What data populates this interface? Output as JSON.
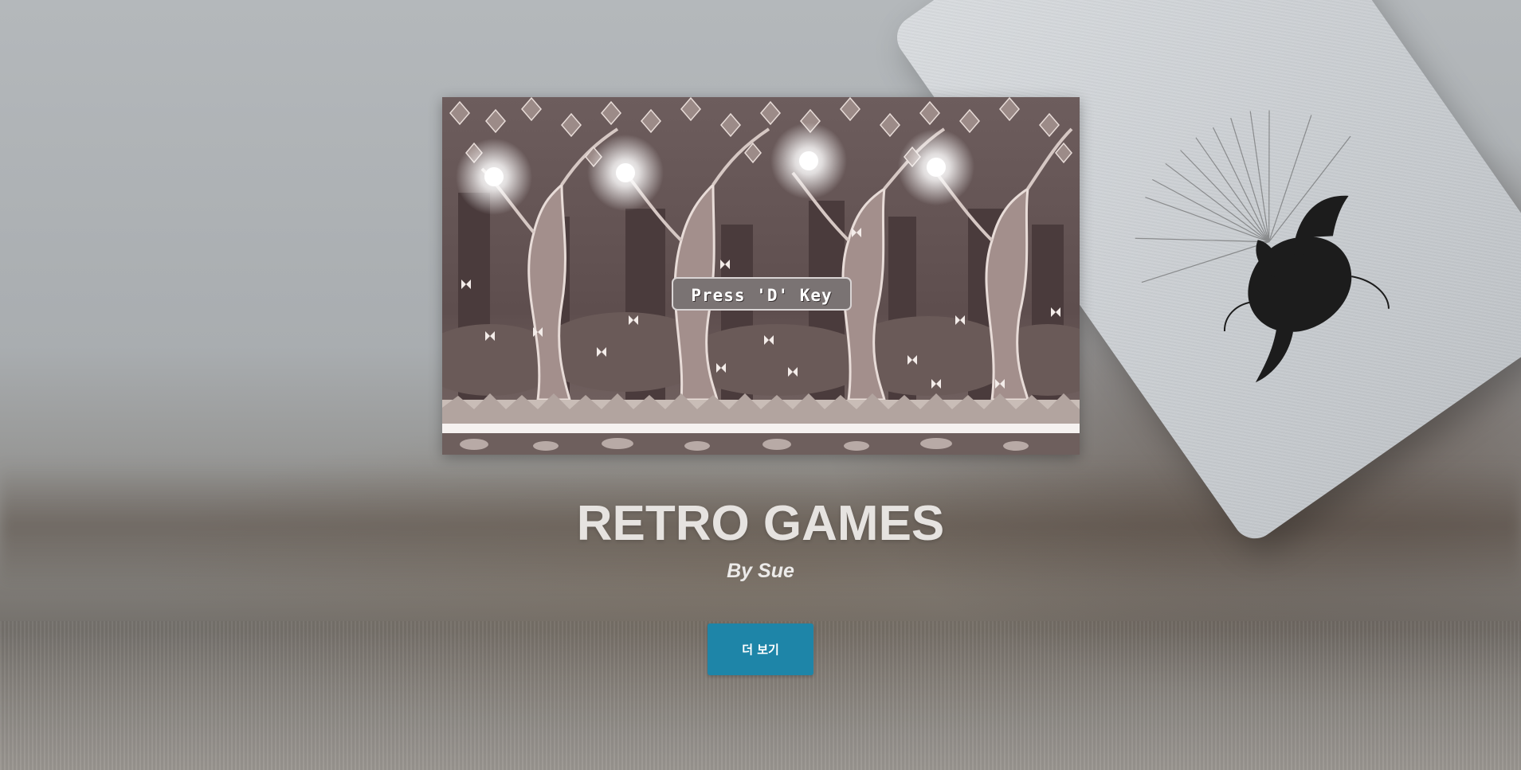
{
  "hero": {
    "game_prompt": "Press 'D' Key",
    "title": "RETRO GAMES",
    "subtitle": "By Sue",
    "more_button_label": "더 보기"
  },
  "colors": {
    "button_bg": "#1e85a8",
    "title_text": "#e6e3e0",
    "game_frame": "#4a3a3a"
  },
  "icons": {
    "game_scene": "enchanted-forest-scene",
    "card_art": "angel-engraving"
  }
}
